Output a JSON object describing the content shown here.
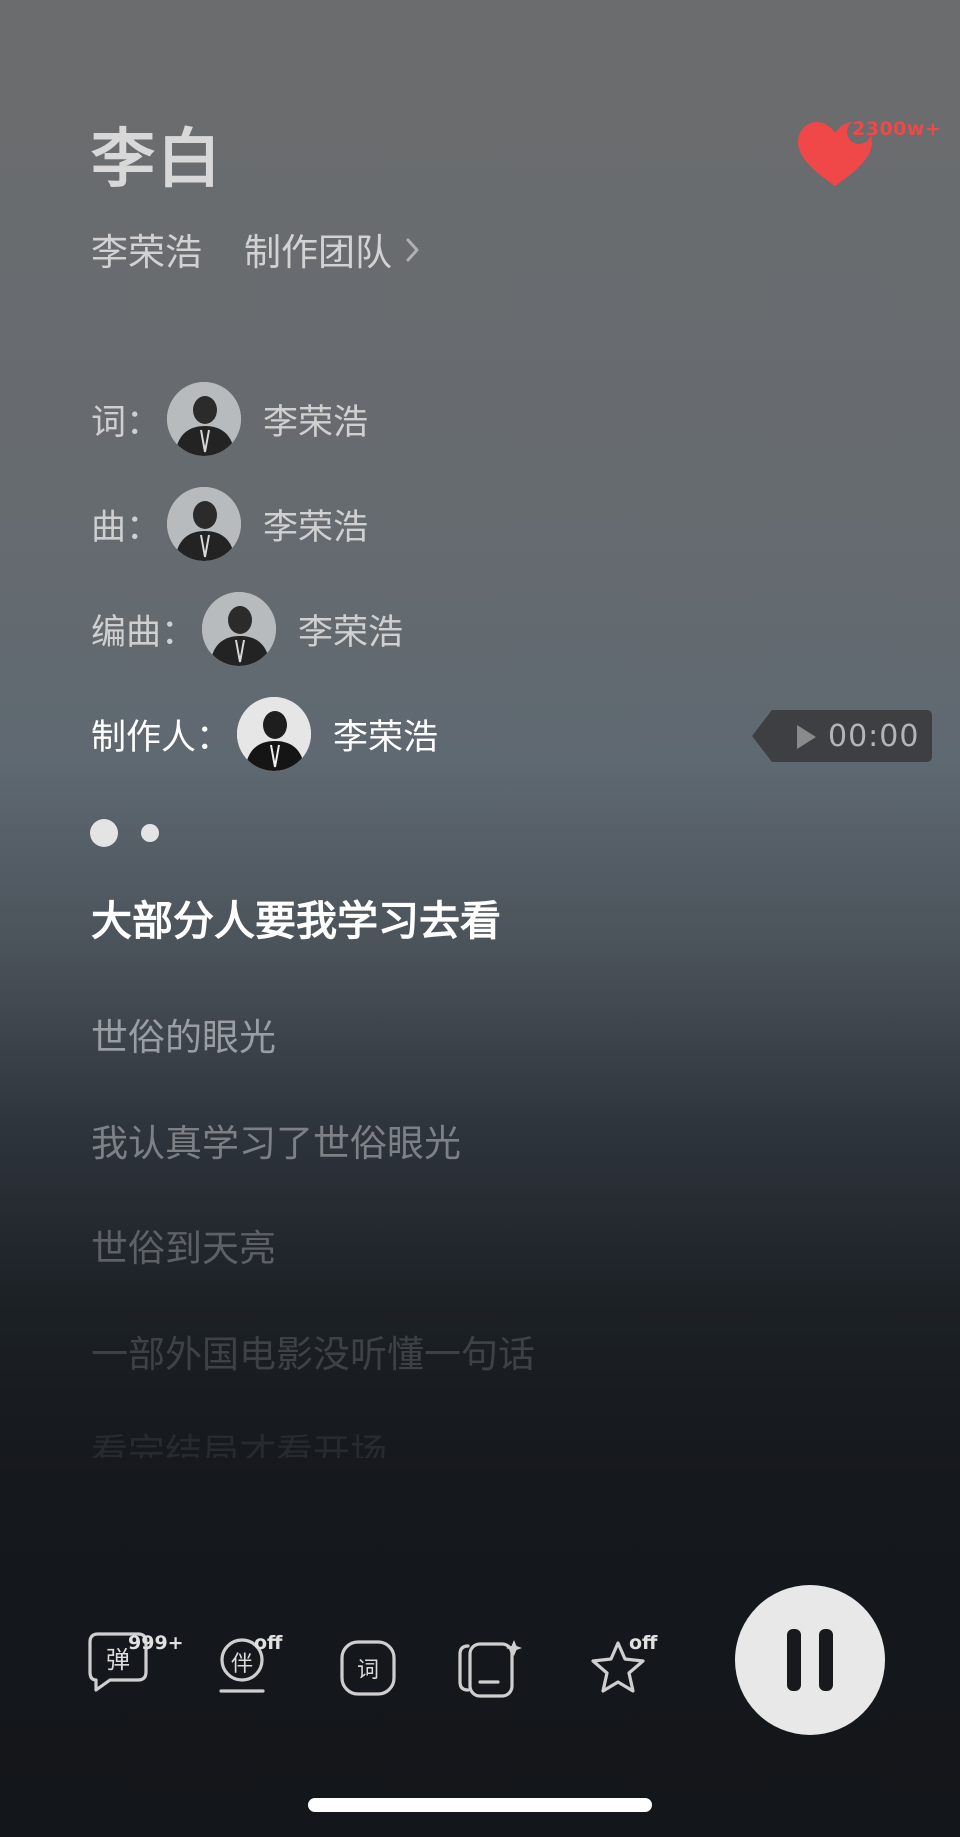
{
  "song": {
    "title": "李白",
    "artist": "李荣浩",
    "team_label": "制作团队",
    "like_count": "2300w+"
  },
  "credits": [
    {
      "label": "词：",
      "name": "李荣浩"
    },
    {
      "label": "曲：",
      "name": "李荣浩"
    },
    {
      "label": "编曲：",
      "name": "李荣浩"
    },
    {
      "label": "制作人：",
      "name": "李荣浩"
    }
  ],
  "time": "00:00",
  "lyrics": {
    "current": "大部分人要我学习去看",
    "lines": [
      "世俗的眼光",
      "我认真学习了世俗眼光",
      "世俗到天亮",
      "一部外国电影没听懂一句话",
      "看完结局才看开场"
    ]
  },
  "toolbar": {
    "danmaku_label": "弹",
    "danmaku_count": "999+",
    "accompany_label": "伴",
    "accompany_state": "off",
    "lyrics_label": "词",
    "favorite_state": "off"
  },
  "colors": {
    "like": "#f04848",
    "play_button": "#e8e8e8"
  },
  "icons": [
    "heart-icon",
    "chevron-right-icon",
    "play-icon",
    "comment-icon",
    "accompany-icon",
    "lyrics-icon",
    "image-sparkle-icon",
    "star-icon",
    "pause-icon"
  ]
}
